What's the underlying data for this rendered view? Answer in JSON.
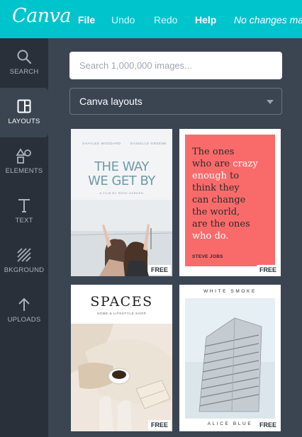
{
  "topbar": {
    "logo": "Canva",
    "menu": [
      "File",
      "Undo",
      "Redo",
      "Help"
    ],
    "status": "No changes made"
  },
  "sidebar": {
    "items": [
      {
        "label": "SEARCH",
        "icon": "search-icon"
      },
      {
        "label": "LAYOUTS",
        "icon": "layouts-icon",
        "active": true
      },
      {
        "label": "ELEMENTS",
        "icon": "elements-icon"
      },
      {
        "label": "TEXT",
        "icon": "text-icon"
      },
      {
        "label": "BKGROUND",
        "icon": "background-icon"
      },
      {
        "label": "UPLOADS",
        "icon": "uploads-icon"
      }
    ]
  },
  "panel": {
    "search_placeholder": "Search 1,000,000 images...",
    "category": "Canva layouts",
    "badge": "FREE",
    "layouts": [
      {
        "credit_left": "SHAYLEE WOODARD",
        "credit_right": "DANIELLE GREENE",
        "title_line1": "THE WAY",
        "title_line2": "WE GET BY",
        "subtitle": "A FILM BY REED GARDEN"
      },
      {
        "quote": [
          {
            "text": "The ones",
            "accent": false
          },
          {
            "text": "who are ",
            "accent": false
          },
          {
            "text": "crazy",
            "accent": true
          },
          {
            "text": "enough",
            "accent": true
          },
          {
            "text": " to",
            "accent": false
          },
          {
            "text": "think they",
            "accent": false
          },
          {
            "text": "can change",
            "accent": false
          },
          {
            "text": "the world,",
            "accent": false
          },
          {
            "text": "are the ones",
            "accent": false
          },
          {
            "text": "who do.",
            "accent": true
          }
        ],
        "author": "STEVE JOBS"
      },
      {
        "title": "SPACES",
        "subtitle": "HOME & LIFESTYLE SHOP"
      },
      {
        "title": "WHITE SMOKE",
        "author": "ALICE BLUE"
      }
    ]
  },
  "colors": {
    "brand": "#00c4cc",
    "sidebar": "#293039",
    "panel": "#3b4552",
    "quote_card": "#f96b6b"
  }
}
